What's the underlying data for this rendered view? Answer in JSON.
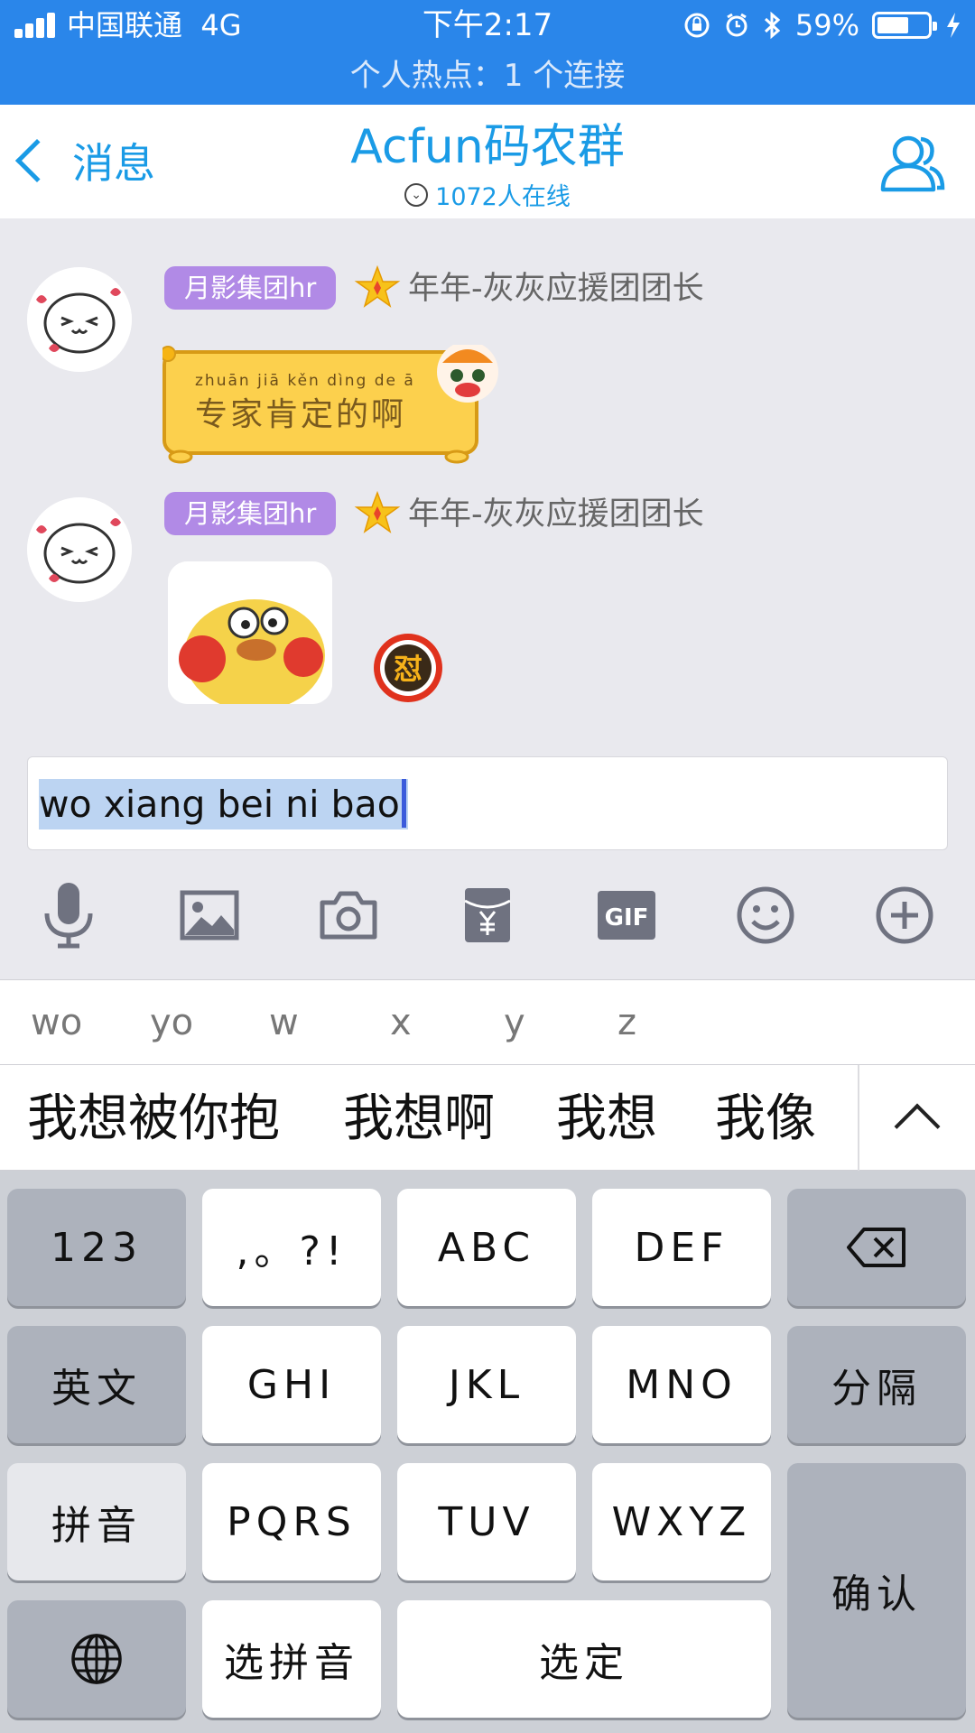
{
  "status_bar": {
    "carrier": "中国联通",
    "network": "4G",
    "time": "下午2:17",
    "battery_percent": "59%",
    "hotspot": "个人热点：1 个连接"
  },
  "header": {
    "back_label": "消息",
    "title": "Acfun码农群",
    "online_count": "1072人在线"
  },
  "messages": [
    {
      "badge": "月影集团hr",
      "sender": "年年-灰灰应援团团长",
      "sticker_pinyin": "zhuān jiā  kěn dìng  de    ā",
      "sticker_text": "专家肯定的啊"
    },
    {
      "badge": "月影集团hr",
      "sender": "年年-灰灰应援团团长",
      "reaction_badge": "怼"
    }
  ],
  "input": {
    "value": "wo xiang bei ni bao"
  },
  "toolbar": {
    "gif_label": "GIF",
    "items": [
      "mic-icon",
      "image-icon",
      "camera-icon",
      "red-packet-icon",
      "gif-icon",
      "emoji-icon",
      "plus-icon"
    ]
  },
  "keyboard": {
    "pinyin_options": [
      "wo",
      "yo",
      "w",
      "x",
      "y",
      "z"
    ],
    "candidates": [
      "我想被你抱",
      "我想啊",
      "我想",
      "我像"
    ],
    "keys": {
      "num": "123",
      "punct": ",。?!",
      "abc": "ABC",
      "def": "DEF",
      "eng": "英文",
      "ghi": "GHI",
      "jkl": "JKL",
      "mno": "MNO",
      "sep": "分隔",
      "pinyin": "拼音",
      "pqrs": "PQRS",
      "tuv": "TUV",
      "wxyz": "WXYZ",
      "confirm": "确认",
      "choose_pinyin": "选拼音",
      "choose": "选定"
    }
  },
  "colors": {
    "status_blue": "#2a86ea",
    "accent_blue": "#1a9be6",
    "badge_purple": "#b18ae6"
  }
}
